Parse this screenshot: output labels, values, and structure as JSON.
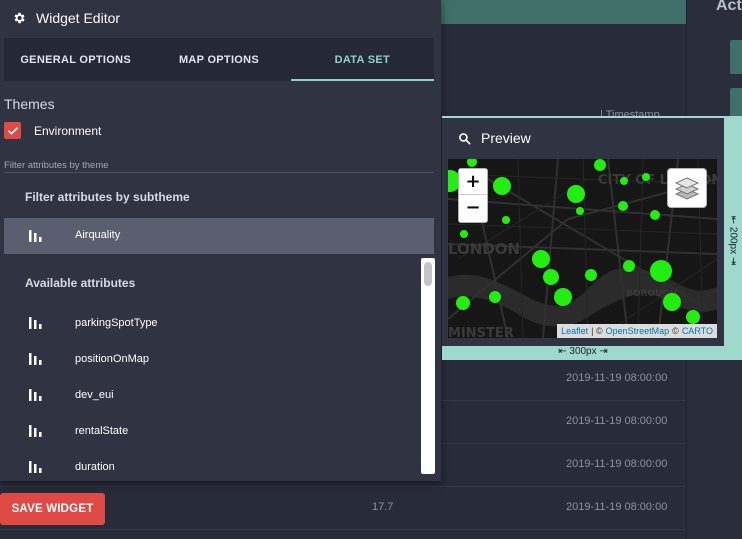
{
  "background": {
    "right_title": "Act",
    "table_header": "Timestamp",
    "rows": [
      {
        "value": "",
        "timestamp": "2019-11-19 08:00:00"
      },
      {
        "value": "",
        "timestamp": "2019-11-19 08:00:00"
      },
      {
        "value": "",
        "timestamp": "2019-11-19 08:00:00"
      },
      {
        "value": "17.7",
        "timestamp": "2019-11-19 08:00:00"
      }
    ]
  },
  "editor": {
    "title": "Widget Editor",
    "icon": "gear-icon",
    "tabs": [
      {
        "label": "GENERAL OPTIONS",
        "active": false
      },
      {
        "label": "MAP OPTIONS",
        "active": false
      },
      {
        "label": "DATA SET",
        "active": true
      }
    ],
    "themes_label": "Themes",
    "theme_checkbox": {
      "label": "Environment",
      "checked": true
    },
    "filter_theme_label": "Filter attributes by theme",
    "subtheme_header": "Filter attributes by subtheme",
    "subtheme_selected": "Airquality",
    "available_header": "Available attributes",
    "attributes": [
      "parkingSpotType",
      "positionOnMap",
      "dev_eui",
      "rentalState",
      "duration"
    ],
    "save_label": "SAVE WIDGET"
  },
  "preview": {
    "title": "Preview",
    "zoom_in": "+",
    "zoom_out": "−",
    "attribution": {
      "leaflet": "Leaflet",
      "sep1": "| ©",
      "osm": "OpenStreetMap",
      "sep2": "©",
      "carto": "CARTO"
    },
    "map_labels": [
      "CITY OF LONDON",
      "LONDON",
      "BOROUGH",
      "MINSTER"
    ],
    "height_label": "⇤ 200px ⇥",
    "width_label": "⇤ 300px ⇥"
  },
  "colors": {
    "accent": "#8fd3c8",
    "danger": "#e04a44",
    "marker": "#22ee11"
  }
}
